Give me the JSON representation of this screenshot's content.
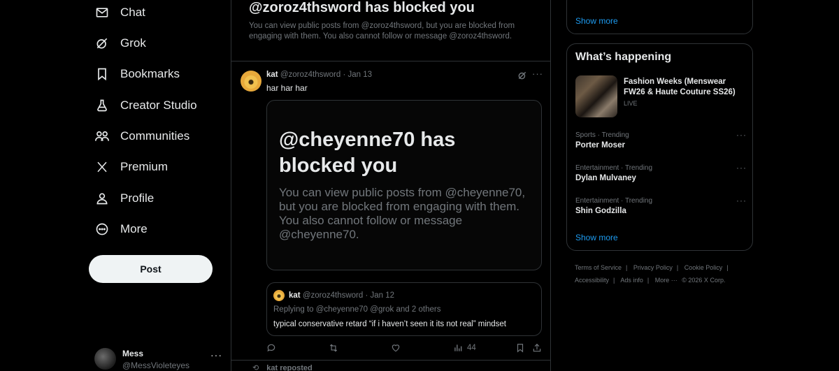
{
  "nav": {
    "items": [
      {
        "label": "Chat",
        "icon": "mail-icon"
      },
      {
        "label": "Grok",
        "icon": "grok-icon"
      },
      {
        "label": "Bookmarks",
        "icon": "bookmark-icon"
      },
      {
        "label": "Creator Studio",
        "icon": "flask-icon"
      },
      {
        "label": "Communities",
        "icon": "communities-icon"
      },
      {
        "label": "Premium",
        "icon": "x-logo-icon"
      },
      {
        "label": "Profile",
        "icon": "person-icon"
      },
      {
        "label": "More",
        "icon": "more-circle-icon"
      }
    ],
    "post_label": "Post"
  },
  "account": {
    "name": "Mess",
    "handle": "@MessVioleteyes",
    "more": "···"
  },
  "blocked_notice": {
    "title": "@zoroz4thsword has blocked you",
    "description": "You can view public posts from @zoroz4thsword, but you are blocked from engaging with them. You also cannot follow or message @zoroz4thsword."
  },
  "tweet": {
    "name": "kat",
    "handle": "@zoroz4thsword",
    "date": "Jan 13",
    "text": "har har har",
    "media": {
      "title": "@cheyenne70 has blocked you",
      "description": "You can view public posts from @cheyenne70, but you are blocked from engaging with them. You also cannot follow or message @cheyenne70."
    },
    "quote": {
      "name": "kat",
      "handle": "@zoroz4thsword",
      "date": "Jan 12",
      "replying_to": "Replying to @cheyenne70 @grok and 2 others",
      "text": "typical conservative retard “if i haven’t seen it its not real” mindset"
    },
    "views": "44"
  },
  "next_item": {
    "repost_text": "kat reposted"
  },
  "sidebar": {
    "top_show_more": "Show more",
    "trends_title": "What’s happening",
    "featured": {
      "title": "Fashion Weeks (Menswear FW26 & Haute Couture SS26)",
      "status": "LIVE"
    },
    "trends": [
      {
        "category": "Sports · Trending",
        "name": "Porter Moser"
      },
      {
        "category": "Entertainment · Trending",
        "name": "Dylan Mulvaney"
      },
      {
        "category": "Entertainment · Trending",
        "name": "Shin Godzilla"
      }
    ],
    "show_more": "Show more"
  },
  "footer": {
    "links": [
      "Terms of Service",
      "Privacy Policy",
      "Cookie Policy",
      "Accessibility",
      "Ads info",
      "More ···"
    ],
    "copyright": "© 2026 X Corp."
  },
  "colors": {
    "background": "#000000",
    "text": "#e7e9ea",
    "muted": "#71767b",
    "accent": "#1d9bf0",
    "border": "#2f3336"
  }
}
